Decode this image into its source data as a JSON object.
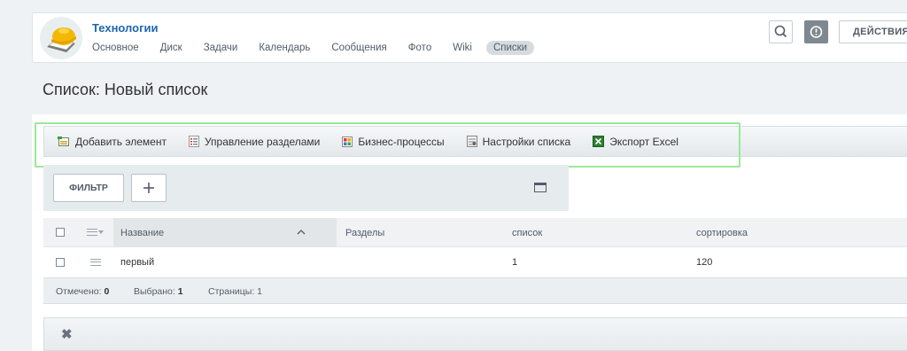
{
  "header": {
    "group_title": "Технологии",
    "nav": [
      "Основное",
      "Диск",
      "Задачи",
      "Календарь",
      "Сообщения",
      "Фото",
      "Wiki",
      "Списки"
    ],
    "active_nav": "Списки",
    "actions_label": "ДЕЙСТВИЯ"
  },
  "page": {
    "title": "Список: Новый список"
  },
  "toolbar": {
    "add_element": "Добавить элемент",
    "manage_sections": "Управление разделами",
    "business_processes": "Бизнес-процессы",
    "list_settings": "Настройки списка",
    "export_excel": "Экспорт Excel"
  },
  "filter": {
    "filter_label": "ФИЛЬТР",
    "add_label": "+"
  },
  "grid": {
    "columns": [
      "Название",
      "Разделы",
      "список",
      "сортировка"
    ],
    "rows": [
      {
        "name": "первый",
        "sections": "",
        "list": "1",
        "sort": "120"
      }
    ]
  },
  "footer": {
    "marked_label": "Отмечено:",
    "marked_value": "0",
    "selected_label": "Выбрано:",
    "selected_value": "1",
    "pages_label": "Страницы:",
    "pages_value": "1"
  },
  "colors": {
    "accent": "#2067b0",
    "highlight": "#9be89b"
  }
}
